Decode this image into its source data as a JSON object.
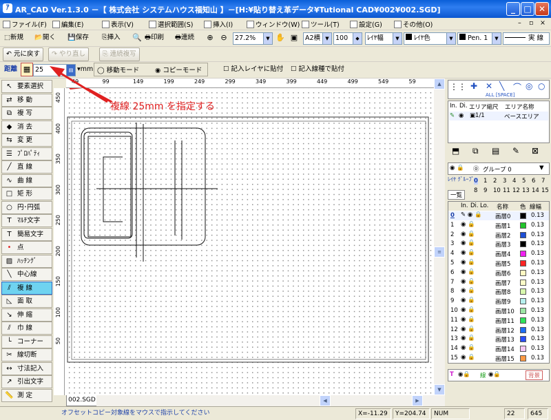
{
  "window": {
    "title": "AR_CAD Ver.1.3.0 －【 株式会社 システムハウス福知山 】－[H:¥貼り替え革データ¥Tutional CAD¥002¥002.SGD]"
  },
  "menu": [
    "ファイル(F)",
    "編集(E)",
    "表示(V)",
    "選択範囲(S)",
    "挿入(I)",
    "ウィンドウ(W)",
    "ツール(T)",
    "設定(G)",
    "その他(O)"
  ],
  "toolbar1": {
    "new": "新規",
    "open": "開く",
    "save": "保存",
    "insert": "挿入",
    "print": "印刷",
    "continuous": "連続",
    "zoom": "27.2%",
    "paper": "A2横",
    "scale": "100",
    "layer_width": "ﾚｲﾔ幅",
    "layer_color": "ﾚｲﾔ色",
    "pen": "Pen. 1",
    "line_type": "実 線"
  },
  "toolbar2": {
    "undo": "元に戻す",
    "redo": "やり直し",
    "repeat": "連続複写"
  },
  "toolbar3": {
    "distance_label": "距離",
    "distance_value": "25",
    "unit": "mm",
    "move_mode": "移動モード",
    "copy_mode": "コピーモード",
    "paste_layer": "記入レイヤに貼付",
    "paste_line": "記入線種で貼付"
  },
  "tools": [
    {
      "icon": "cursor-icon",
      "label": "要素選択"
    },
    {
      "icon": "move-icon",
      "label": "移 動"
    },
    {
      "icon": "copy-icon",
      "label": "複 写"
    },
    {
      "icon": "eraser-icon",
      "label": "消 去"
    },
    {
      "icon": "change-icon",
      "label": "変 更"
    },
    {
      "icon": "property-icon",
      "label": "ﾌﾟﾛﾊﾟﾃｨ"
    },
    {
      "icon": "line-icon",
      "label": "直 線"
    },
    {
      "icon": "curve-icon",
      "label": "曲 線"
    },
    {
      "icon": "rectangle-icon",
      "label": "矩 形"
    },
    {
      "icon": "circle-icon",
      "label": "円･円弧"
    },
    {
      "icon": "multitext-icon",
      "label": "ﾏﾙﾁ文字"
    },
    {
      "icon": "text-icon",
      "label": "簡易文字"
    },
    {
      "icon": "point-icon",
      "label": "点"
    },
    {
      "icon": "hatching-icon",
      "label": "ﾊｯﾁﾝｸﾞ"
    },
    {
      "icon": "centerline-icon",
      "label": "中心線"
    },
    {
      "icon": "offset-line-icon",
      "label": "複 線"
    },
    {
      "icon": "chamfer-icon",
      "label": "面 取"
    },
    {
      "icon": "extend-icon",
      "label": "伸 縮"
    },
    {
      "icon": "trim-icon",
      "label": "巾 線"
    },
    {
      "icon": "corner-icon",
      "label": "コーナー"
    },
    {
      "icon": "cut-line-icon",
      "label": "線切断"
    },
    {
      "icon": "dimension-icon",
      "label": "寸法記入"
    },
    {
      "icon": "leader-text-icon",
      "label": "引出文字"
    },
    {
      "icon": "measure-icon",
      "label": "測 定"
    }
  ],
  "active_tool": 15,
  "ruler_top": [
    "49",
    "99",
    "149",
    "199",
    "249",
    "299",
    "349",
    "399",
    "449",
    "499",
    "549",
    "59"
  ],
  "ruler_left": [
    "450",
    "400",
    "350",
    "300",
    "250",
    "200",
    "150",
    "100",
    "50"
  ],
  "annotation": {
    "text": "複線 25mm を指定する",
    "color": "#e02020"
  },
  "tab_name": "002.SGD",
  "status": {
    "message": "オフセットコピー対象線をマウスで指示してください",
    "x": "X=-11.29",
    "y": "Y=204.74",
    "num": "NUM",
    "a": "22",
    "b": "645"
  },
  "right": {
    "all_space": "ALL [SPACE]",
    "area_headers": [
      "In.",
      "Di.",
      "エリア縮尺",
      "エリア名称"
    ],
    "area_row": {
      "scale": "1/1",
      "name": "ベースエリア"
    },
    "group_label": "グループ 0",
    "layer_group_label": "ﾚｲﾔ ｸﾞﾙｰﾌﾟ",
    "list_label": "一覧",
    "group_nums": [
      "0",
      "1",
      "2",
      "3",
      "4",
      "5",
      "6",
      "7",
      "8",
      "9",
      "10",
      "11",
      "12",
      "13",
      "14",
      "15"
    ],
    "layer_headers": [
      "In.",
      "Di.",
      "Lo.",
      "名称",
      "色",
      "線幅"
    ],
    "layers": [
      {
        "num": "0",
        "name": "画層0",
        "color": "#000000",
        "width": "0.13"
      },
      {
        "num": "1",
        "name": "画層1",
        "color": "#21c42b",
        "width": "0.13"
      },
      {
        "num": "2",
        "name": "画層2",
        "color": "#1e4fd6",
        "width": "0.13"
      },
      {
        "num": "3",
        "name": "画層3",
        "color": "#000000",
        "width": "0.13"
      },
      {
        "num": "4",
        "name": "画層4",
        "color": "#f021f0",
        "width": "0.13"
      },
      {
        "num": "5",
        "name": "画層5",
        "color": "#ff2424",
        "width": "0.13"
      },
      {
        "num": "6",
        "name": "画層6",
        "color": "#fff7c2",
        "width": "0.13"
      },
      {
        "num": "7",
        "name": "画層7",
        "color": "#fbfbc8",
        "width": "0.13"
      },
      {
        "num": "8",
        "name": "画層8",
        "color": "#d8f9ae",
        "width": "0.13"
      },
      {
        "num": "9",
        "name": "画層9",
        "color": "#b7f0ee",
        "width": "0.13"
      },
      {
        "num": "10",
        "name": "画層10",
        "color": "#9ce6a5",
        "width": "0.13"
      },
      {
        "num": "11",
        "name": "画層11",
        "color": "#2fe35a",
        "width": "0.13"
      },
      {
        "num": "12",
        "name": "画層12",
        "color": "#1d6df4",
        "width": "0.13"
      },
      {
        "num": "13",
        "name": "画層13",
        "color": "#2a4fff",
        "width": "0.13"
      },
      {
        "num": "14",
        "name": "画層14",
        "color": "#f7c8f5",
        "width": "0.13"
      },
      {
        "num": "15",
        "name": "画層15",
        "color": "#ff9a44",
        "width": "0.13"
      }
    ],
    "footer": {
      "T": "T",
      "line": "線",
      "bg": "背景"
    }
  }
}
